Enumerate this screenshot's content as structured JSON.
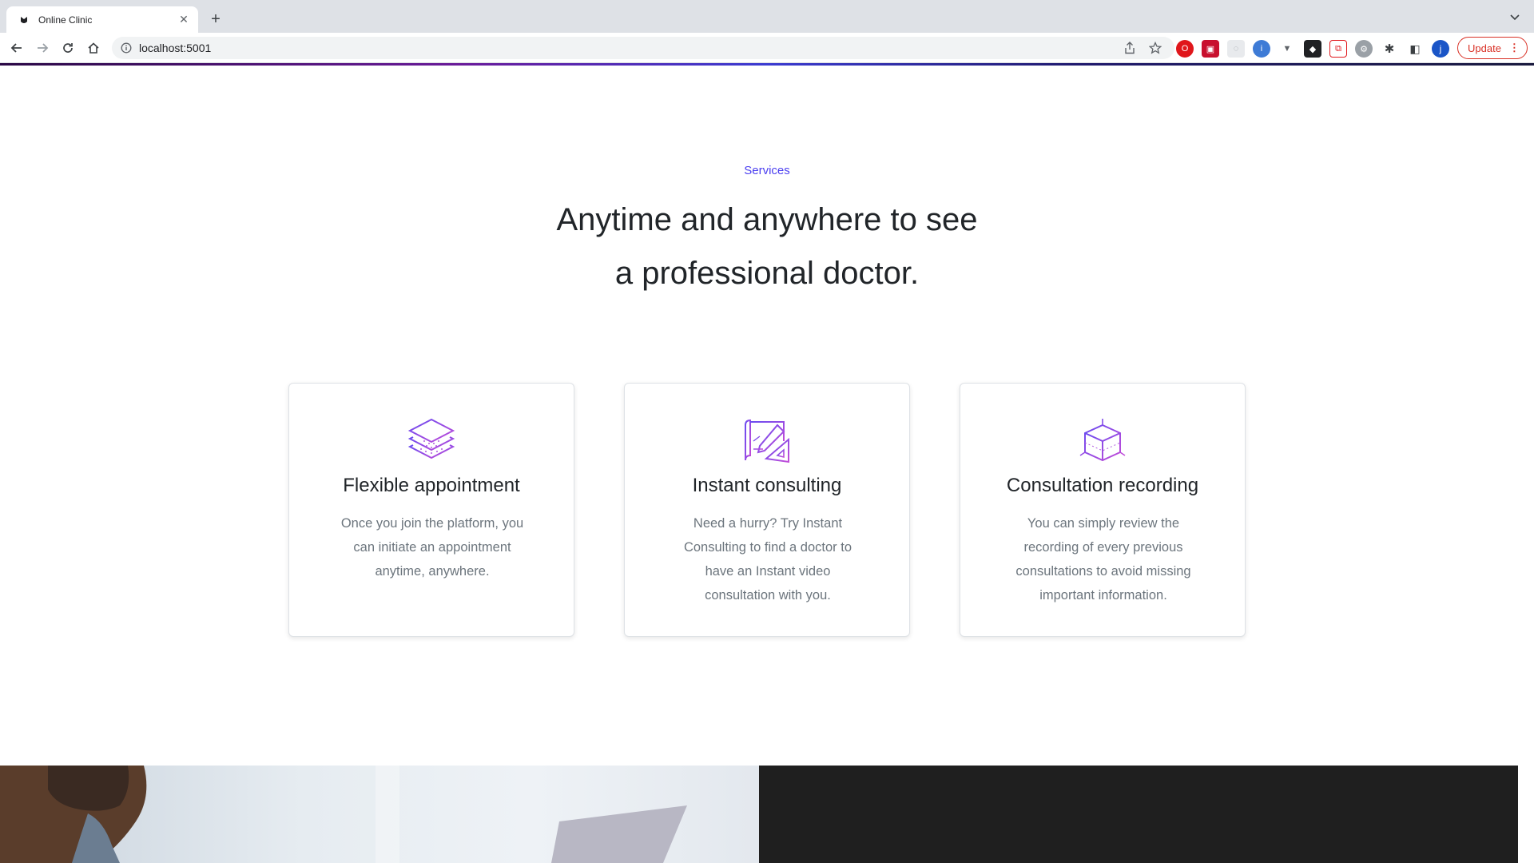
{
  "browser": {
    "tab_title": "Online Clinic",
    "url": "localhost:5001",
    "update_label": "Update",
    "profile_initial": "j"
  },
  "services": {
    "eyebrow": "Services",
    "headline_line1": "Anytime and anywhere to see",
    "headline_line2": "a professional doctor.",
    "cards": [
      {
        "icon": "layers-icon",
        "title": "Flexible appointment",
        "text": "Once you join the platform, you can initiate an appointment anytime, anywhere."
      },
      {
        "icon": "drafting-icon",
        "title": "Instant consulting",
        "text": "Need a hurry? Try Instant Consulting to find a doctor to have an Instant video consultation with you."
      },
      {
        "icon": "cube-icon",
        "title": "Consultation recording",
        "text": "You can simply review the recording of every previous consultations to avoid missing important information."
      }
    ]
  },
  "colors": {
    "accent": "#4b3ff0",
    "icon_stroke": "#8a4ce6",
    "dark_panel": "#1f1f1f"
  }
}
